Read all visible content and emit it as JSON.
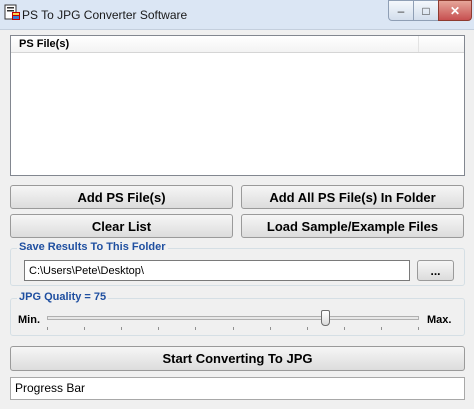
{
  "window": {
    "title": "PS To JPG Converter Software",
    "icon": "app-icon",
    "minimize_glyph": "–",
    "maximize_glyph": "□",
    "close_glyph": "✕"
  },
  "file_list": {
    "column_header": "PS File(s)",
    "items": []
  },
  "buttons": {
    "add_files": "Add PS File(s)",
    "add_folder": "Add All PS File(s) In Folder",
    "clear_list": "Clear List",
    "load_sample": "Load Sample/Example Files",
    "start": "Start Converting To JPG"
  },
  "output": {
    "legend": "Save Results To This Folder",
    "path": "C:\\Users\\Pete\\Desktop\\",
    "browse_label": "..."
  },
  "quality": {
    "legend": "JPG Quality = 75",
    "min_label": "Min.",
    "max_label": "Max.",
    "value": 75,
    "min": 0,
    "max": 100
  },
  "progress": {
    "label": "Progress Bar",
    "value": 0
  },
  "colors": {
    "legend_text": "#1f4fa0",
    "progress_fill": "#06b025"
  }
}
